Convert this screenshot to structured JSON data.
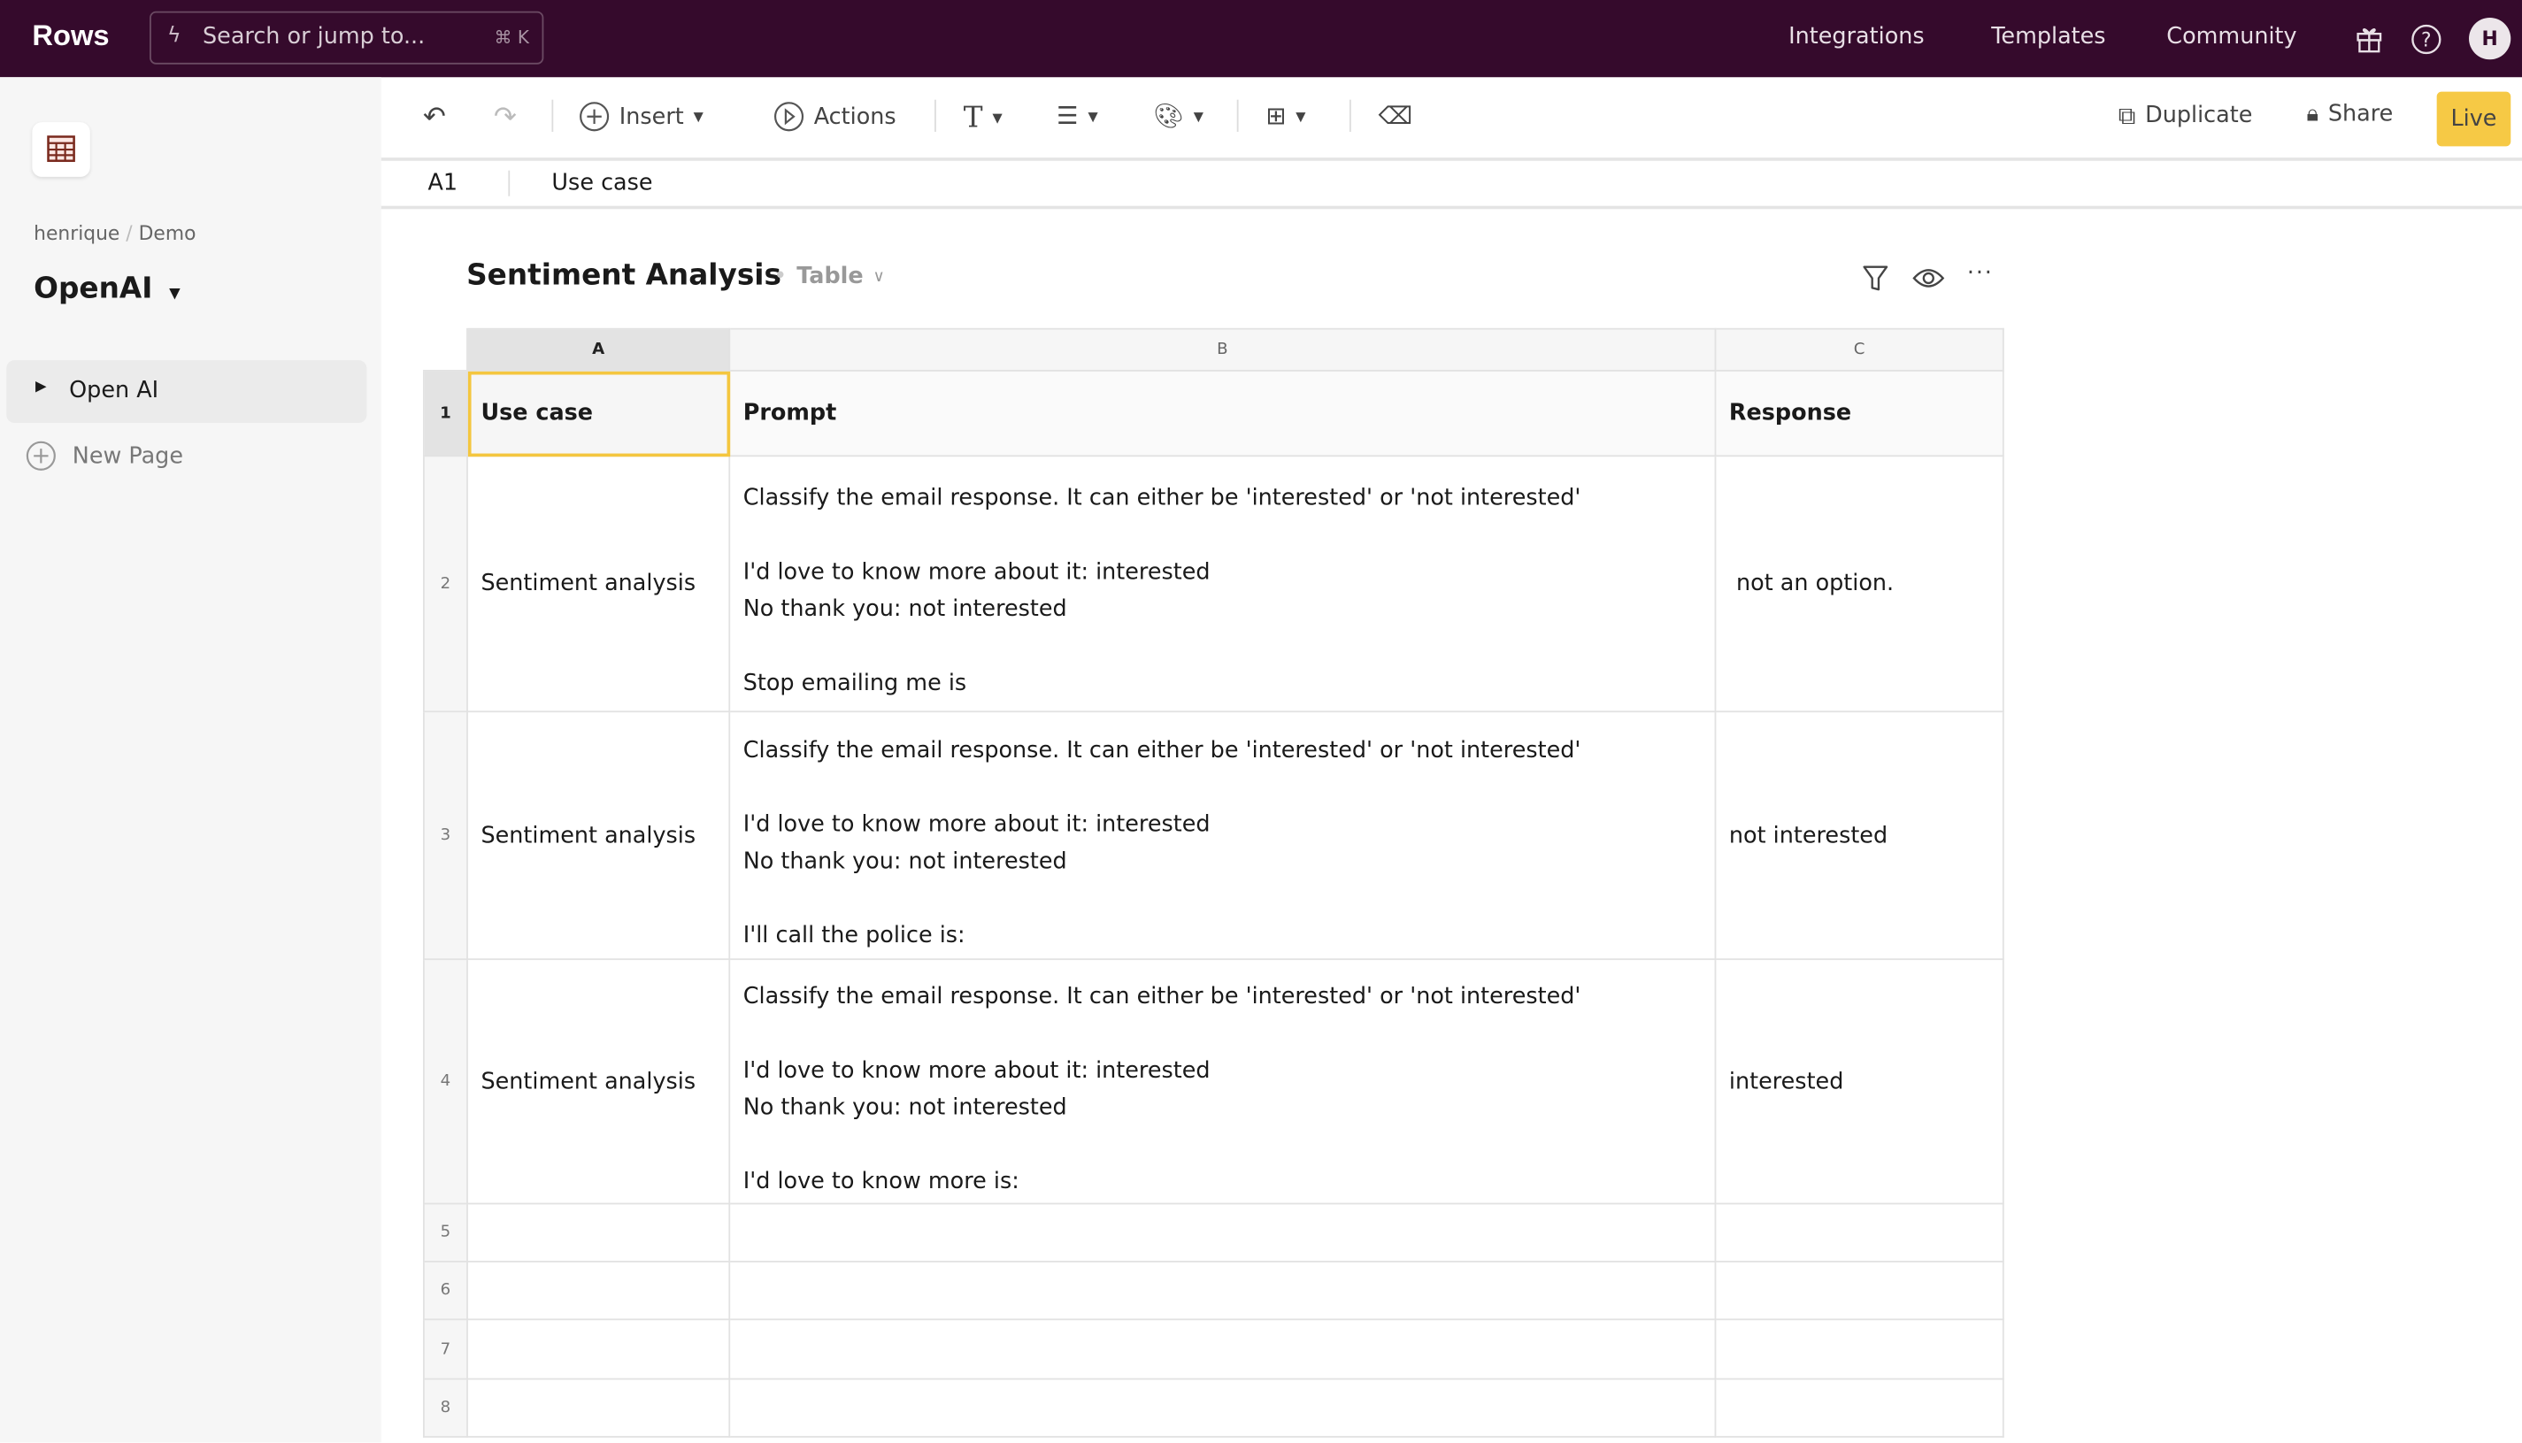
{
  "app": {
    "logo": "Rows"
  },
  "search": {
    "placeholder": "Search or jump to...",
    "shortcut": "⌘ K"
  },
  "topnav": {
    "items": [
      "Integrations",
      "Templates",
      "Community"
    ],
    "avatar_initial": "H"
  },
  "sidebar": {
    "breadcrumb": {
      "user": "henrique",
      "sep": "/",
      "folder": "Demo"
    },
    "spreadsheet_title": "OpenAI",
    "pages": [
      {
        "label": "Open AI",
        "active": true
      }
    ],
    "new_page_label": "New Page"
  },
  "toolbar": {
    "insert_label": "Insert",
    "actions_label": "Actions",
    "duplicate_label": "Duplicate",
    "share_label": "Share",
    "live_label": "Live"
  },
  "formula_bar": {
    "cell_ref": "A1",
    "value": "Use case"
  },
  "table": {
    "title": "Sentiment Analysis",
    "view": "Table",
    "columns": [
      "A",
      "B",
      "C"
    ],
    "rows": [
      {
        "num": "1",
        "a": "Use case",
        "b": "Prompt",
        "c": "Response"
      },
      {
        "num": "2",
        "a": "Sentiment analysis",
        "b": "Classify the email response. It can either be 'interested' or 'not interested'\n\nI'd love to know more about it: interested\nNo thank you: not interested\n\nStop emailing me is",
        "c": " not an option."
      },
      {
        "num": "3",
        "a": "Sentiment analysis",
        "b": "Classify the email response. It can either be 'interested' or 'not interested'\n\nI'd love to know more about it: interested\nNo thank you: not interested\n\n I'll call the police is:",
        "c": "not interested"
      },
      {
        "num": "4",
        "a": "Sentiment analysis",
        "b": "Classify the email response. It can either be 'interested' or 'not interested'\n\nI'd love to know more about it: interested\nNo thank you: not interested\n\n I'd love to know more is:",
        "c": "interested"
      },
      {
        "num": "5",
        "a": "",
        "b": "",
        "c": ""
      },
      {
        "num": "6",
        "a": "",
        "b": "",
        "c": ""
      },
      {
        "num": "7",
        "a": "",
        "b": "",
        "c": ""
      },
      {
        "num": "8",
        "a": "",
        "b": "",
        "c": ""
      }
    ]
  },
  "colors": {
    "topbar": "#350a2c",
    "accent": "#f4c63f",
    "sidebar": "#f6f6f6"
  }
}
